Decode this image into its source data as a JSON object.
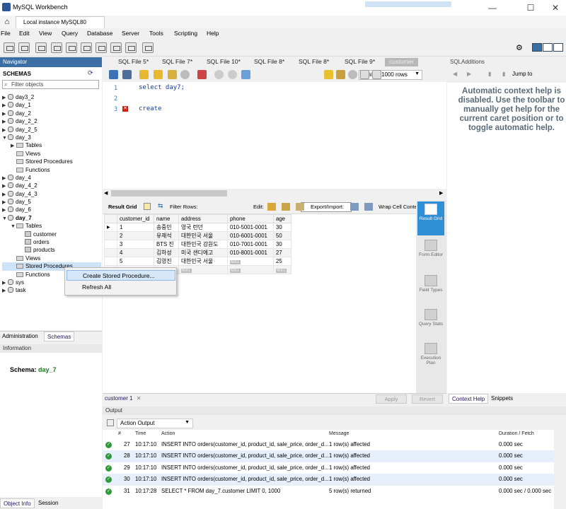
{
  "window": {
    "title": "MySQL Workbench",
    "minimize": "—",
    "maximize": "☐",
    "close": "✕"
  },
  "connection_tab": "Local instance MySQL80",
  "menu": [
    "File",
    "Edit",
    "View",
    "Query",
    "Database",
    "Server",
    "Tools",
    "Scripting",
    "Help"
  ],
  "navigator": {
    "header": "Navigator",
    "schemas_label": "SCHEMAS",
    "filter_placeholder": "Filter objects",
    "tree": [
      {
        "label": "day3_2",
        "level": 0,
        "type": "db",
        "expanded": false
      },
      {
        "label": "day_1",
        "level": 0,
        "type": "db",
        "expanded": false
      },
      {
        "label": "day_2",
        "level": 0,
        "type": "db",
        "expanded": false
      },
      {
        "label": "day_2_2",
        "level": 0,
        "type": "db",
        "expanded": false
      },
      {
        "label": "day_2_5",
        "level": 0,
        "type": "db",
        "expanded": false
      },
      {
        "label": "day_3",
        "level": 0,
        "type": "db",
        "expanded": true
      },
      {
        "label": "Tables",
        "level": 1,
        "type": "folder",
        "expanded": false
      },
      {
        "label": "Views",
        "level": 1,
        "type": "folder-leaf"
      },
      {
        "label": "Stored Procedures",
        "level": 1,
        "type": "folder-leaf"
      },
      {
        "label": "Functions",
        "level": 1,
        "type": "folder-leaf"
      },
      {
        "label": "day_4",
        "level": 0,
        "type": "db",
        "expanded": false
      },
      {
        "label": "day_4_2",
        "level": 0,
        "type": "db",
        "expanded": false
      },
      {
        "label": "day_4_3",
        "level": 0,
        "type": "db",
        "expanded": false
      },
      {
        "label": "day_5",
        "level": 0,
        "type": "db",
        "expanded": false
      },
      {
        "label": "day_6",
        "level": 0,
        "type": "db",
        "expanded": false
      },
      {
        "label": "day_7",
        "level": 0,
        "type": "db",
        "expanded": true,
        "bold": true
      },
      {
        "label": "Tables",
        "level": 1,
        "type": "folder",
        "expanded": true
      },
      {
        "label": "customer",
        "level": 2,
        "type": "table"
      },
      {
        "label": "orders",
        "level": 2,
        "type": "table"
      },
      {
        "label": "products",
        "level": 2,
        "type": "table"
      },
      {
        "label": "Views",
        "level": 1,
        "type": "folder-leaf"
      },
      {
        "label": "Stored Procedures",
        "level": 1,
        "type": "folder-leaf",
        "selected": true
      },
      {
        "label": "Functions",
        "level": 1,
        "type": "folder-leaf"
      },
      {
        "label": "sys",
        "level": 0,
        "type": "db",
        "expanded": false
      },
      {
        "label": "task",
        "level": 0,
        "type": "db",
        "expanded": false
      }
    ],
    "bottom_tabs": {
      "administration": "Administration",
      "schemas": "Schemas"
    },
    "information_header": "Information",
    "schema_label": "Schema:",
    "schema_value": "day_7",
    "info_tabs": {
      "object_info": "Object Info",
      "session": "Session"
    }
  },
  "context_menu": {
    "items": [
      "Create Stored Procedure...",
      "Refresh All"
    ]
  },
  "editor_tabs": [
    "SQL File 5*",
    "SQL File 7*",
    "SQL File 10*",
    "SQL File 8*",
    "SQL File 8*",
    "SQL File 9*",
    "customer"
  ],
  "editor_toolbar": {
    "limit": "Limit to 1000 rows"
  },
  "editor": {
    "lines": [
      {
        "num": "1",
        "code": "select day7;"
      },
      {
        "num": "2",
        "code": ""
      },
      {
        "num": "3",
        "code": "create"
      }
    ]
  },
  "result_toolbar": {
    "result_grid": "Result Grid",
    "filter_rows": "Filter Rows:",
    "edit": "Edit:",
    "export_import": "Export/Import:",
    "wrap": "Wrap Cell Conte"
  },
  "result_grid": {
    "columns": [
      "customer_id",
      "name",
      "address",
      "phone",
      "age"
    ],
    "rows": [
      [
        "1",
        "송중민",
        "영국 런던",
        "010-5001-0001",
        "30"
      ],
      [
        "2",
        "유재석",
        "대한민국 서울",
        "010-6001-0001",
        "50"
      ],
      [
        "3",
        "BTS 진",
        "대한민국 강원도",
        "010-7001-0001",
        "30"
      ],
      [
        "4",
        "김하성",
        "미국 샌디에고",
        "010-8001-0001",
        "27"
      ],
      [
        "5",
        "김영진",
        "대한민국 서울",
        "NULL",
        "25"
      ],
      [
        "NULL",
        "NULL",
        "NULL",
        "NULL",
        "NULL"
      ]
    ],
    "null_label": "NULL"
  },
  "right_sidebar": [
    "Result Grid",
    "Form Editor",
    "Field Types",
    "Query Stats",
    "Execution Plan"
  ],
  "result_bottom": {
    "tab": "customer 1",
    "apply": "Apply",
    "revert": "Revert"
  },
  "sql_additions": {
    "header": "SQLAdditions",
    "jump_to": "Jump to",
    "help_text": "Automatic context help is disabled. Use the toolbar to manually get help for the current caret position or to toggle automatic help.",
    "tabs": {
      "context_help": "Context Help",
      "snippets": "Snippets"
    }
  },
  "output": {
    "header": "Output",
    "selector": "Action Output",
    "columns": [
      "#",
      "Time",
      "Action",
      "Message",
      "Duration / Fetch"
    ],
    "rows": [
      {
        "n": "27",
        "time": "10:17:10",
        "action": "INSERT INTO orders(customer_id, product_id, sale_price, order_d...",
        "message": "1 row(s) affected",
        "duration": "0.000 sec"
      },
      {
        "n": "28",
        "time": "10:17:10",
        "action": "INSERT INTO orders(customer_id, product_id, sale_price, order_d...",
        "message": "1 row(s) affected",
        "duration": "0.000 sec"
      },
      {
        "n": "29",
        "time": "10:17:10",
        "action": "INSERT INTO orders(customer_id, product_id, sale_price, order_d...",
        "message": "1 row(s) affected",
        "duration": "0.000 sec"
      },
      {
        "n": "30",
        "time": "10:17:10",
        "action": "INSERT INTO orders(customer_id, product_id, sale_price, order_d...",
        "message": "1 row(s) affected",
        "duration": "0.000 sec"
      },
      {
        "n": "31",
        "time": "10:17:28",
        "action": "SELECT * FROM day_7.customer LIMIT 0, 1000",
        "message": "5 row(s) returned",
        "duration": "0.000 sec / 0.000 sec"
      }
    ]
  },
  "colors": {
    "accent": "#3b6ea5",
    "selection": "#cde3f8",
    "keyword": "#153ea3",
    "ok": "#2e9a3a",
    "error": "#cc2211"
  }
}
